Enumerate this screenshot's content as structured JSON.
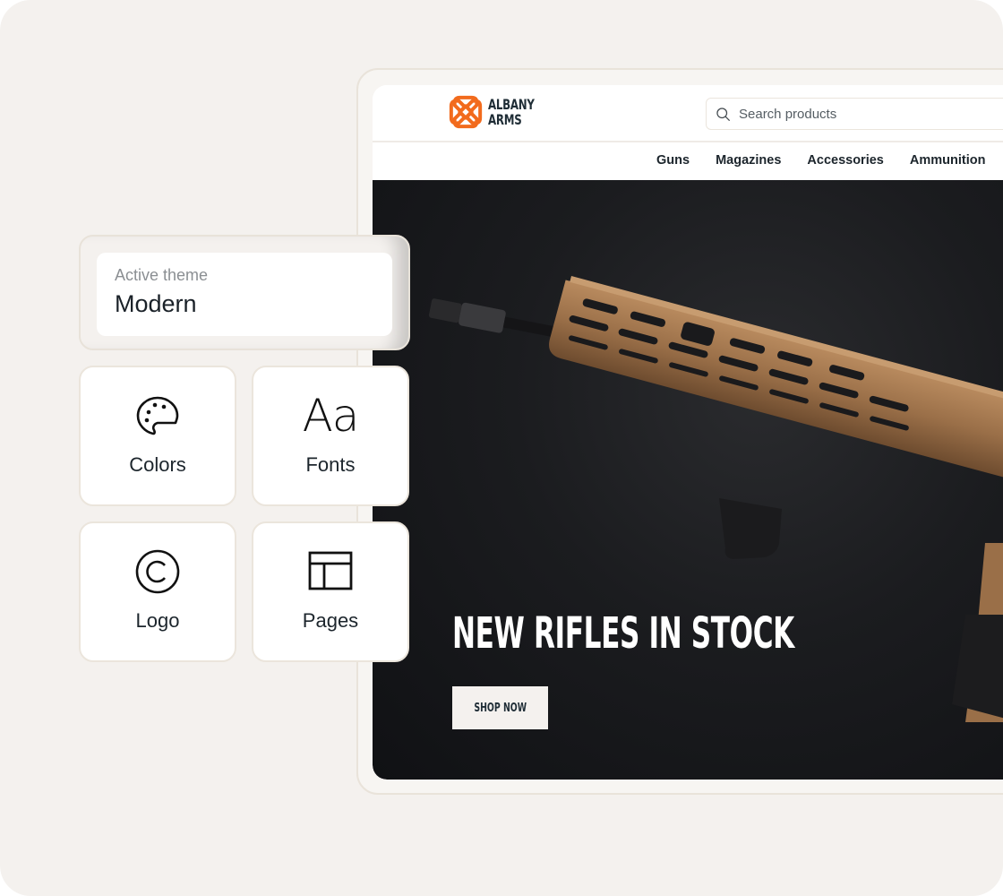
{
  "site": {
    "brand": {
      "line1": "ALBANY",
      "line2": "ARMS",
      "accent_color": "#f26b1d"
    },
    "search": {
      "placeholder": "Search products",
      "value": "",
      "icon": "search-icon"
    },
    "nav": [
      {
        "label": "Guns"
      },
      {
        "label": "Magazines"
      },
      {
        "label": "Accessories"
      },
      {
        "label": "Ammunition"
      }
    ],
    "hero": {
      "title": "NEW RIFLES IN STOCK",
      "cta_label": "SHOP NOW",
      "image": "rifle-product-photo"
    }
  },
  "theme_panel": {
    "active_label": "Active theme",
    "active_value": "Modern",
    "tiles": [
      {
        "label": "Colors",
        "icon": "palette-icon"
      },
      {
        "label": "Fonts",
        "icon": "font-icon",
        "glyph": "Aa"
      },
      {
        "label": "Logo",
        "icon": "copyright-icon"
      },
      {
        "label": "Pages",
        "icon": "layout-icon"
      }
    ]
  }
}
